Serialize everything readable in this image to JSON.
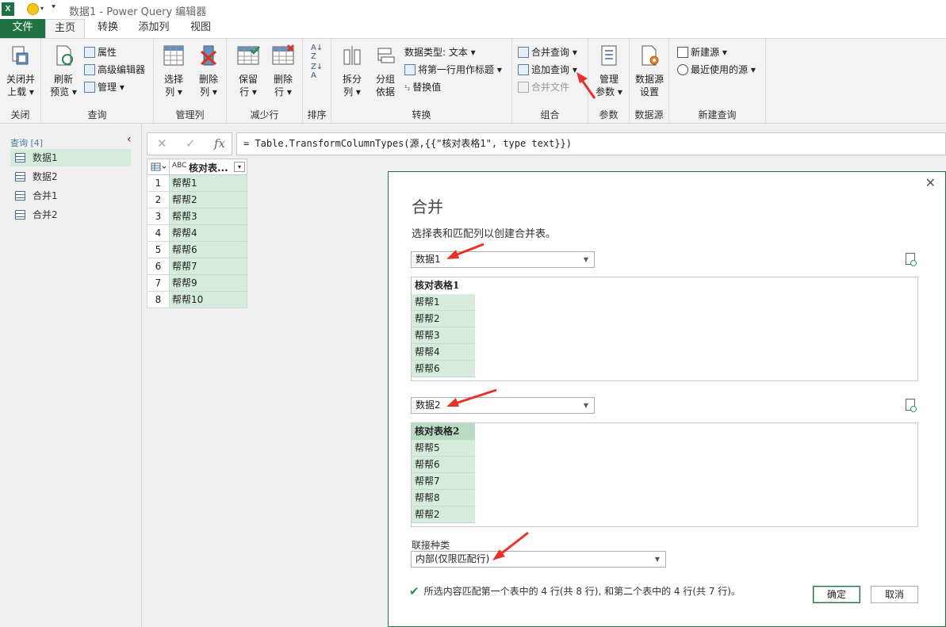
{
  "window": {
    "title": "数据1 - Power Query 编辑器",
    "app_icon": "X",
    "file_tab": "文件"
  },
  "tabs": [
    "主页",
    "转换",
    "添加列",
    "视图"
  ],
  "ribbon": {
    "groups": {
      "close": "关闭",
      "query": "查询",
      "manage_cols": "管理列",
      "reduce_rows": "减少行",
      "sort": "排序",
      "transform": "转换",
      "combine": "组合",
      "params": "参数",
      "datasource": "数据源",
      "new_query": "新建查询"
    },
    "close_load": [
      "关闭并",
      "上载"
    ],
    "refresh_preview": [
      "刷新",
      "预览"
    ],
    "properties": "属性",
    "advanced_editor": "高级编辑器",
    "manage": "管理",
    "choose_cols": [
      "选择",
      "列"
    ],
    "remove_cols": [
      "删除",
      "列"
    ],
    "keep_rows": [
      "保留",
      "行"
    ],
    "remove_rows": [
      "删除",
      "行"
    ],
    "split": [
      "拆分",
      "列"
    ],
    "group_by": [
      "分组",
      "依据"
    ],
    "datatype": "数据类型: 文本",
    "first_row_header": "将第一行用作标题",
    "replace_values": "替换值",
    "merge_queries": "合并查询",
    "append_queries": "追加查询",
    "combine_files": "合并文件",
    "manage_params": [
      "管理",
      "参数"
    ],
    "ds_settings": [
      "数据源",
      "设置"
    ],
    "new_source": "新建源",
    "recent_sources": "最近使用的源"
  },
  "queries": {
    "header": "查询 [4]",
    "items": [
      "数据1",
      "数据2",
      "合并1",
      "合并2"
    ]
  },
  "formula": "= Table.TransformColumnTypes(源,{{\"核对表格1\", type text}})",
  "grid": {
    "column": "核对表...",
    "type_label": "ABC",
    "rows": [
      {
        "n": "1",
        "v": "帮帮1"
      },
      {
        "n": "2",
        "v": "帮帮2"
      },
      {
        "n": "3",
        "v": "帮帮3"
      },
      {
        "n": "4",
        "v": "帮帮4"
      },
      {
        "n": "5",
        "v": "帮帮6"
      },
      {
        "n": "6",
        "v": "帮帮7"
      },
      {
        "n": "7",
        "v": "帮帮9"
      },
      {
        "n": "8",
        "v": "帮帮10"
      }
    ]
  },
  "dialog": {
    "title": "合并",
    "desc": "选择表和匹配列以创建合并表。",
    "table1": {
      "selected": "数据1",
      "column": "核对表格1",
      "rows": [
        "帮帮1",
        "帮帮2",
        "帮帮3",
        "帮帮4",
        "帮帮6"
      ]
    },
    "table2": {
      "selected": "数据2",
      "column": "核对表格2",
      "rows": [
        "帮帮5",
        "帮帮6",
        "帮帮7",
        "帮帮8",
        "帮帮2"
      ]
    },
    "join_label": "联接种类",
    "join_value": "内部(仅限匹配行)",
    "status": "所选内容匹配第一个表中的 4 行(共 8 行), 和第二个表中的 4 行(共 7 行)。",
    "ok": "确定",
    "cancel": "取消"
  },
  "colors": {
    "accent": "#217346",
    "selection": "#d5ecdc",
    "annotation": "#e8312a"
  }
}
